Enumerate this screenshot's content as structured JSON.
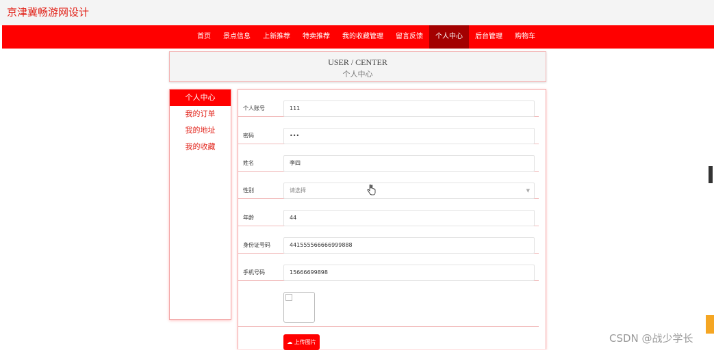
{
  "header": {
    "site_title": "京津冀畅游网设计"
  },
  "nav": {
    "items": [
      {
        "label": "首页"
      },
      {
        "label": "景点信息"
      },
      {
        "label": "上新推荐"
      },
      {
        "label": "特卖推荐"
      },
      {
        "label": "我的收藏管理"
      },
      {
        "label": "留言反馈"
      },
      {
        "label": "个人中心"
      },
      {
        "label": "后台管理"
      },
      {
        "label": "购物车"
      }
    ],
    "active_index": 6
  },
  "banner": {
    "title_en": "USER / CENTER",
    "title_cn": "个人中心"
  },
  "sidebar": {
    "items": [
      {
        "label": "个人中心"
      },
      {
        "label": "我的订单"
      },
      {
        "label": "我的地址"
      },
      {
        "label": "我的收藏"
      }
    ],
    "active_index": 0
  },
  "form": {
    "fields": [
      {
        "label": "个人账号",
        "value": "111"
      },
      {
        "label": "密码",
        "value": "•••"
      },
      {
        "label": "姓名",
        "value": "李四"
      },
      {
        "label": "性别",
        "placeholder": "请选择"
      },
      {
        "label": "年龄",
        "value": "44"
      },
      {
        "label": "身份证号码",
        "value": "441555566666999888"
      },
      {
        "label": "手机号码",
        "value": "15666699898"
      }
    ],
    "upload_label": "上传图片"
  },
  "watermark": "CSDN @战少学长",
  "colors": {
    "accent": "#ff0000",
    "nav_active": "#a30000",
    "title": "#e2231a"
  }
}
